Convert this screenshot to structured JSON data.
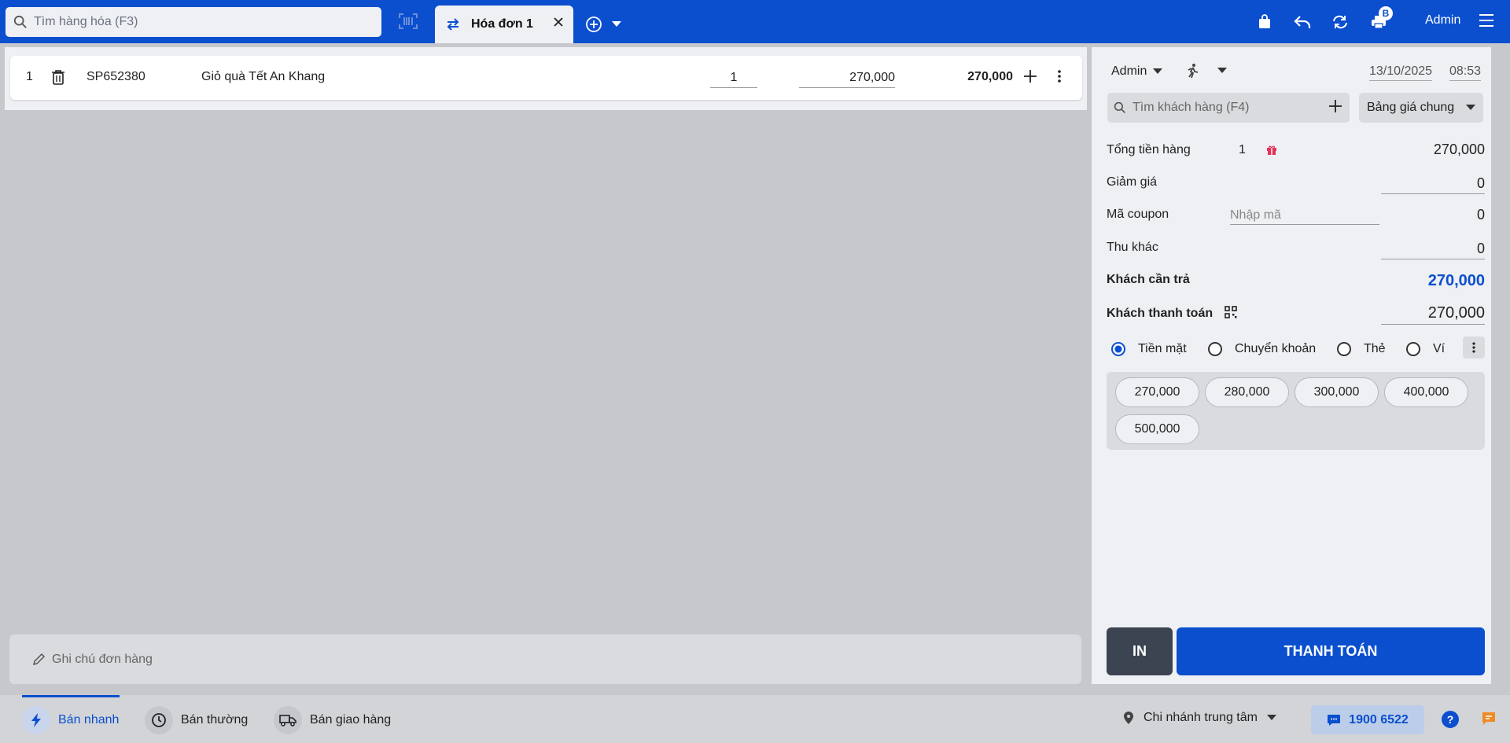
{
  "colors": {
    "primary": "#0b4fcf",
    "background": "#c6c8cc",
    "panel": "#eef0f4",
    "gift": "#e0335c",
    "dark_button": "#3c4452"
  },
  "topbar": {
    "search_placeholder": "Tìm hàng hóa (F3)",
    "tab_label": "Hóa đơn 1",
    "badge": "B",
    "user": "Admin",
    "icons": [
      "search-icon",
      "barcode-scan-icon",
      "swap-icon",
      "close-icon",
      "add-circle-icon",
      "caret-down-icon",
      "bag-icon",
      "undo-icon",
      "refresh-icon",
      "printer-icon",
      "menu-icon"
    ]
  },
  "cart": {
    "rows": [
      {
        "index": "1",
        "code": "SP652380",
        "name": "Giỏ quà Tết An Khang",
        "qty": "1",
        "price": "270,000",
        "total": "270,000"
      }
    ]
  },
  "note": {
    "placeholder": "Ghi chú đơn hàng"
  },
  "panel": {
    "seller": "Admin",
    "date": "13/10/2025",
    "time": "08:53",
    "customer_placeholder": "Tìm khách hàng (F4)",
    "price_book": "Bảng giá chung",
    "total_goods": {
      "label": "Tổng tiền hàng",
      "count": "1",
      "value": "270,000"
    },
    "discount": {
      "label": "Giảm giá",
      "value": "0"
    },
    "coupon": {
      "label": "Mã coupon",
      "placeholder": "Nhập mã",
      "value": "0"
    },
    "other_fee": {
      "label": "Thu khác",
      "value": "0"
    },
    "to_pay": {
      "label": "Khách cần trả",
      "value": "270,000"
    },
    "paid": {
      "label": "Khách thanh toán",
      "value": "270,000"
    },
    "methods": [
      {
        "label": "Tiền mặt",
        "selected": true
      },
      {
        "label": "Chuyển khoản",
        "selected": false
      },
      {
        "label": "Thẻ",
        "selected": false
      },
      {
        "label": "Ví",
        "selected": false
      }
    ],
    "quick_amounts": [
      "270,000",
      "280,000",
      "300,000",
      "400,000",
      "500,000"
    ],
    "print_label": "IN",
    "pay_label": "THANH TOÁN"
  },
  "bottom": {
    "modes": [
      "Bán nhanh",
      "Bán thường",
      "Bán giao hàng"
    ],
    "active_mode": "Bán nhanh",
    "branch": "Chi nhánh trung tâm",
    "hotline": "1900 6522",
    "help": "?"
  }
}
